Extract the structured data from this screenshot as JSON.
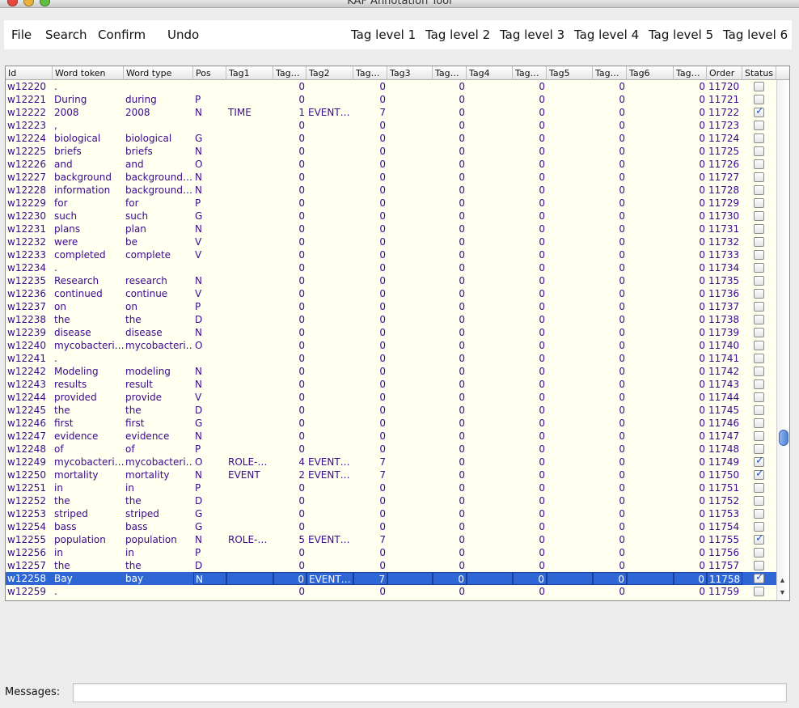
{
  "window": {
    "title": "KAF Annotation Tool"
  },
  "menu": {
    "file": "File",
    "search": "Search",
    "confirm": "Confirm",
    "undo": "Undo",
    "tag_levels": [
      "Tag level 1",
      "Tag level 2",
      "Tag level 3",
      "Tag level 4",
      "Tag level 5",
      "Tag level 6"
    ]
  },
  "table": {
    "columns": [
      "Id",
      "Word token",
      "Word type",
      "Pos",
      "Tag1",
      "Tag…",
      "Tag2",
      "Tag…",
      "Tag3",
      "Tag…",
      "Tag4",
      "Tag…",
      "Tag5",
      "Tag…",
      "Tag6",
      "Tag…",
      "Order",
      "Status"
    ],
    "rows": [
      [
        "w12220",
        ".",
        "",
        "",
        "",
        "0",
        "",
        "0",
        "",
        "0",
        "",
        "0",
        "",
        "0",
        "",
        "0",
        "11720",
        false
      ],
      [
        "w12221",
        "During",
        "during",
        "P",
        "",
        "0",
        "",
        "0",
        "",
        "0",
        "",
        "0",
        "",
        "0",
        "",
        "0",
        "11721",
        false
      ],
      [
        "w12222",
        "2008",
        "2008",
        "N",
        "TIME",
        "1",
        "EVENT…",
        "7",
        "",
        "0",
        "",
        "0",
        "",
        "0",
        "",
        "0",
        "11722",
        true
      ],
      [
        "w12223",
        ",",
        "",
        "",
        "",
        "0",
        "",
        "0",
        "",
        "0",
        "",
        "0",
        "",
        "0",
        "",
        "0",
        "11723",
        false
      ],
      [
        "w12224",
        "biological",
        "biological",
        "G",
        "",
        "0",
        "",
        "0",
        "",
        "0",
        "",
        "0",
        "",
        "0",
        "",
        "0",
        "11724",
        false
      ],
      [
        "w12225",
        "briefs",
        "briefs",
        "N",
        "",
        "0",
        "",
        "0",
        "",
        "0",
        "",
        "0",
        "",
        "0",
        "",
        "0",
        "11725",
        false
      ],
      [
        "w12226",
        "and",
        "and",
        "O",
        "",
        "0",
        "",
        "0",
        "",
        "0",
        "",
        "0",
        "",
        "0",
        "",
        "0",
        "11726",
        false
      ],
      [
        "w12227",
        "background",
        "background…",
        "N",
        "",
        "0",
        "",
        "0",
        "",
        "0",
        "",
        "0",
        "",
        "0",
        "",
        "0",
        "11727",
        false
      ],
      [
        "w12228",
        "information",
        "background…",
        "N",
        "",
        "0",
        "",
        "0",
        "",
        "0",
        "",
        "0",
        "",
        "0",
        "",
        "0",
        "11728",
        false
      ],
      [
        "w12229",
        "for",
        "for",
        "P",
        "",
        "0",
        "",
        "0",
        "",
        "0",
        "",
        "0",
        "",
        "0",
        "",
        "0",
        "11729",
        false
      ],
      [
        "w12230",
        "such",
        "such",
        "G",
        "",
        "0",
        "",
        "0",
        "",
        "0",
        "",
        "0",
        "",
        "0",
        "",
        "0",
        "11730",
        false
      ],
      [
        "w12231",
        "plans",
        "plan",
        "N",
        "",
        "0",
        "",
        "0",
        "",
        "0",
        "",
        "0",
        "",
        "0",
        "",
        "0",
        "11731",
        false
      ],
      [
        "w12232",
        "were",
        "be",
        "V",
        "",
        "0",
        "",
        "0",
        "",
        "0",
        "",
        "0",
        "",
        "0",
        "",
        "0",
        "11732",
        false
      ],
      [
        "w12233",
        "completed",
        "complete",
        "V",
        "",
        "0",
        "",
        "0",
        "",
        "0",
        "",
        "0",
        "",
        "0",
        "",
        "0",
        "11733",
        false
      ],
      [
        "w12234",
        ".",
        "",
        "",
        "",
        "0",
        "",
        "0",
        "",
        "0",
        "",
        "0",
        "",
        "0",
        "",
        "0",
        "11734",
        false
      ],
      [
        "w12235",
        "Research",
        "research",
        "N",
        "",
        "0",
        "",
        "0",
        "",
        "0",
        "",
        "0",
        "",
        "0",
        "",
        "0",
        "11735",
        false
      ],
      [
        "w12236",
        "continued",
        "continue",
        "V",
        "",
        "0",
        "",
        "0",
        "",
        "0",
        "",
        "0",
        "",
        "0",
        "",
        "0",
        "11736",
        false
      ],
      [
        "w12237",
        "on",
        "on",
        "P",
        "",
        "0",
        "",
        "0",
        "",
        "0",
        "",
        "0",
        "",
        "0",
        "",
        "0",
        "11737",
        false
      ],
      [
        "w12238",
        "the",
        "the",
        "D",
        "",
        "0",
        "",
        "0",
        "",
        "0",
        "",
        "0",
        "",
        "0",
        "",
        "0",
        "11738",
        false
      ],
      [
        "w12239",
        "disease",
        "disease",
        "N",
        "",
        "0",
        "",
        "0",
        "",
        "0",
        "",
        "0",
        "",
        "0",
        "",
        "0",
        "11739",
        false
      ],
      [
        "w12240",
        "mycobacteri…",
        "mycobacteri…",
        "O",
        "",
        "0",
        "",
        "0",
        "",
        "0",
        "",
        "0",
        "",
        "0",
        "",
        "0",
        "11740",
        false
      ],
      [
        "w12241",
        ".",
        "",
        "",
        "",
        "0",
        "",
        "0",
        "",
        "0",
        "",
        "0",
        "",
        "0",
        "",
        "0",
        "11741",
        false
      ],
      [
        "w12242",
        "Modeling",
        "modeling",
        "N",
        "",
        "0",
        "",
        "0",
        "",
        "0",
        "",
        "0",
        "",
        "0",
        "",
        "0",
        "11742",
        false
      ],
      [
        "w12243",
        "results",
        "result",
        "N",
        "",
        "0",
        "",
        "0",
        "",
        "0",
        "",
        "0",
        "",
        "0",
        "",
        "0",
        "11743",
        false
      ],
      [
        "w12244",
        "provided",
        "provide",
        "V",
        "",
        "0",
        "",
        "0",
        "",
        "0",
        "",
        "0",
        "",
        "0",
        "",
        "0",
        "11744",
        false
      ],
      [
        "w12245",
        "the",
        "the",
        "D",
        "",
        "0",
        "",
        "0",
        "",
        "0",
        "",
        "0",
        "",
        "0",
        "",
        "0",
        "11745",
        false
      ],
      [
        "w12246",
        "first",
        "first",
        "G",
        "",
        "0",
        "",
        "0",
        "",
        "0",
        "",
        "0",
        "",
        "0",
        "",
        "0",
        "11746",
        false
      ],
      [
        "w12247",
        "evidence",
        "evidence",
        "N",
        "",
        "0",
        "",
        "0",
        "",
        "0",
        "",
        "0",
        "",
        "0",
        "",
        "0",
        "11747",
        false
      ],
      [
        "w12248",
        "of",
        "of",
        "P",
        "",
        "0",
        "",
        "0",
        "",
        "0",
        "",
        "0",
        "",
        "0",
        "",
        "0",
        "11748",
        false
      ],
      [
        "w12249",
        "mycobacteri…",
        "mycobacteri…",
        "O",
        "ROLE-…",
        "4",
        "EVENT…",
        "7",
        "",
        "0",
        "",
        "0",
        "",
        "0",
        "",
        "0",
        "11749",
        true
      ],
      [
        "w12250",
        "mortality",
        "mortality",
        "N",
        "EVENT",
        "2",
        "EVENT…",
        "7",
        "",
        "0",
        "",
        "0",
        "",
        "0",
        "",
        "0",
        "11750",
        true
      ],
      [
        "w12251",
        "in",
        "in",
        "P",
        "",
        "0",
        "",
        "0",
        "",
        "0",
        "",
        "0",
        "",
        "0",
        "",
        "0",
        "11751",
        false
      ],
      [
        "w12252",
        "the",
        "the",
        "D",
        "",
        "0",
        "",
        "0",
        "",
        "0",
        "",
        "0",
        "",
        "0",
        "",
        "0",
        "11752",
        false
      ],
      [
        "w12253",
        "striped",
        "striped",
        "G",
        "",
        "0",
        "",
        "0",
        "",
        "0",
        "",
        "0",
        "",
        "0",
        "",
        "0",
        "11753",
        false
      ],
      [
        "w12254",
        "bass",
        "bass",
        "G",
        "",
        "0",
        "",
        "0",
        "",
        "0",
        "",
        "0",
        "",
        "0",
        "",
        "0",
        "11754",
        false
      ],
      [
        "w12255",
        "population",
        "population",
        "N",
        "ROLE-…",
        "5",
        "EVENT…",
        "7",
        "",
        "0",
        "",
        "0",
        "",
        "0",
        "",
        "0",
        "11755",
        true
      ],
      [
        "w12256",
        "in",
        "in",
        "P",
        "",
        "0",
        "",
        "0",
        "",
        "0",
        "",
        "0",
        "",
        "0",
        "",
        "0",
        "11756",
        false
      ],
      [
        "w12257",
        "the",
        "the",
        "D",
        "",
        "0",
        "",
        "0",
        "",
        "0",
        "",
        "0",
        "",
        "0",
        "",
        "0",
        "11757",
        false
      ],
      [
        "w12258",
        "Bay",
        "bay",
        "N",
        "",
        "0",
        "EVENT…",
        "7",
        "",
        "0",
        "",
        "0",
        "",
        "0",
        "",
        "0",
        "11758",
        true
      ],
      [
        "w12259",
        ".",
        "",
        "",
        "",
        "0",
        "",
        "0",
        "",
        "0",
        "",
        "0",
        "",
        "0",
        "",
        "0",
        "11759",
        false
      ]
    ],
    "selected_row": 38
  },
  "messages": {
    "label": "Messages:",
    "value": ""
  }
}
